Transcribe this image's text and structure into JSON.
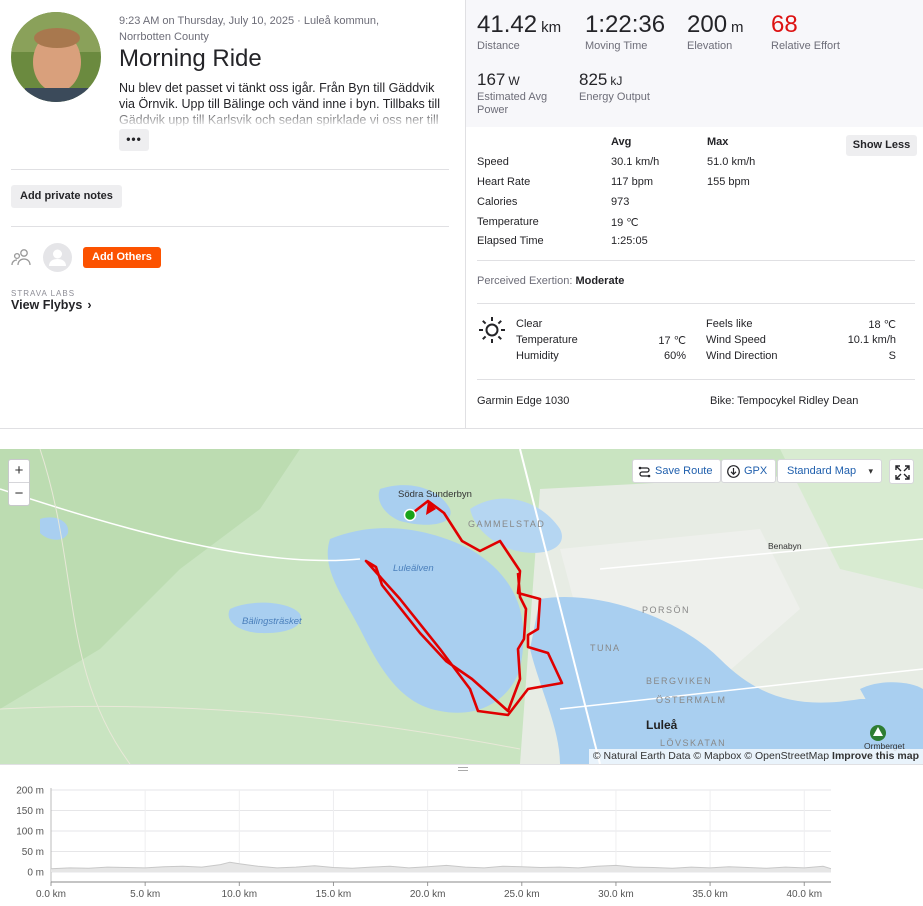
{
  "activity": {
    "meta": "9:23 AM on Thursday, July 10, 2025 · Luleå kommun, Norrbotten County",
    "title": "Morning Ride",
    "description": "Nu blev det passet vi tänkt oss igår. Från Byn till Gäddvik via Örnvik. Upp till Bälinge och vänd inne i byn. Tillbaks till Gäddvik upp till Karlsvik och sedan spirklade vi oss ner till",
    "more_label": "•••",
    "private_notes_label": "Add private notes",
    "add_others_label": "Add Others",
    "labs_label": "STRAVA LABS",
    "flybys_label": "View Flybys",
    "flybys_chevron": "›"
  },
  "stats": {
    "distance": {
      "value": "41.42",
      "unit": "km",
      "label": "Distance"
    },
    "moving_time": {
      "value": "1:22:36",
      "label": "Moving Time"
    },
    "elevation": {
      "value": "200",
      "unit": "m",
      "label": "Elevation"
    },
    "relative_effort": {
      "value": "68",
      "label": "Relative Effort"
    },
    "power": {
      "value": "167",
      "unit": "W",
      "label": "Estimated Avg Power"
    },
    "energy": {
      "value": "825",
      "unit": "kJ",
      "label": "Energy Output"
    }
  },
  "details": {
    "col_avg": "Avg",
    "col_max": "Max",
    "show_less_label": "Show Less",
    "rows": [
      {
        "label": "Speed",
        "avg": "30.1 km/h",
        "max": "51.0 km/h"
      },
      {
        "label": "Heart Rate",
        "avg": "117 bpm",
        "max": "155 bpm"
      },
      {
        "label": "Calories",
        "avg": "973",
        "max": ""
      },
      {
        "label": "Temperature",
        "avg": "19 ℃",
        "max": ""
      },
      {
        "label": "Elapsed Time",
        "avg": "1:25:05",
        "max": ""
      }
    ],
    "exertion_label": "Perceived Exertion:",
    "exertion_value": "Moderate"
  },
  "weather": {
    "condition": "Clear",
    "temperature_label": "Temperature",
    "temperature": "17 ℃",
    "humidity_label": "Humidity",
    "humidity": "60%",
    "feels_like_label": "Feels like",
    "feels_like": "18 ℃",
    "wind_speed_label": "Wind Speed",
    "wind_speed": "10.1 km/h",
    "wind_direction_label": "Wind Direction",
    "wind_direction": "S"
  },
  "gear": {
    "device": "Garmin Edge 1030",
    "bike": "Bike: Tempocykel Ridley Dean"
  },
  "map": {
    "zoom_in": "+",
    "zoom_out": "−",
    "save_route_label": "Save Route",
    "gpx_label": "GPX",
    "style_label": "Standard Map",
    "style_caret": "▾",
    "attribution_prefix": "© Natural Earth Data © Mapbox © OpenStreetMap",
    "attribution_link": "Improve this map",
    "labels": {
      "sodra_sunderbyn": "Södra Sunderbyn",
      "gammelstad": "GAMMELSTAD",
      "benabyn": "Benabyn",
      "lulealven": "Luleälven",
      "balingstrasket": "Bälingsträsket",
      "porson": "PORSÖN",
      "tuna": "TUNA",
      "bergviken": "BERGVIKEN",
      "ostermalm": "ÖSTERMALM",
      "lulea": "Luleå",
      "lovskatan": "LÖVSKATAN",
      "ormberget": "Ormberget"
    },
    "route_color": "#e00000"
  },
  "chart_data": {
    "type": "area",
    "title": "",
    "xlabel": "",
    "ylabel": "",
    "x_ticks": [
      "0.0 km",
      "5.0 km",
      "10.0 km",
      "15.0 km",
      "20.0 km",
      "25.0 km",
      "30.0 km",
      "35.0 km",
      "40.0 km"
    ],
    "y_ticks": [
      "0 m",
      "50 m",
      "100 m",
      "150 m",
      "200 m"
    ],
    "xlim": [
      0,
      41.42
    ],
    "ylim": [
      0,
      200
    ],
    "x": [
      0,
      1,
      2,
      3,
      4,
      5,
      6,
      7,
      8,
      9,
      9.5,
      10,
      11,
      12,
      13,
      14,
      15,
      16,
      17,
      18,
      19,
      20,
      21,
      22,
      23,
      24,
      25,
      26,
      27,
      28,
      29,
      30,
      31,
      32,
      33,
      34,
      35,
      36,
      37,
      38,
      39,
      40,
      41,
      41.42
    ],
    "series": [
      {
        "values": [
          8,
          10,
          9,
          12,
          11,
          10,
          13,
          14,
          12,
          18,
          24,
          20,
          14,
          10,
          12,
          15,
          11,
          9,
          12,
          14,
          10,
          13,
          16,
          12,
          10,
          14,
          13,
          11,
          12,
          10,
          14,
          16,
          12,
          11,
          9,
          12,
          10,
          13,
          11,
          9,
          12,
          10,
          14,
          8
        ]
      }
    ],
    "fill_color": "#e6e6e6",
    "line_color": "#c8c8c8",
    "grid": true
  }
}
